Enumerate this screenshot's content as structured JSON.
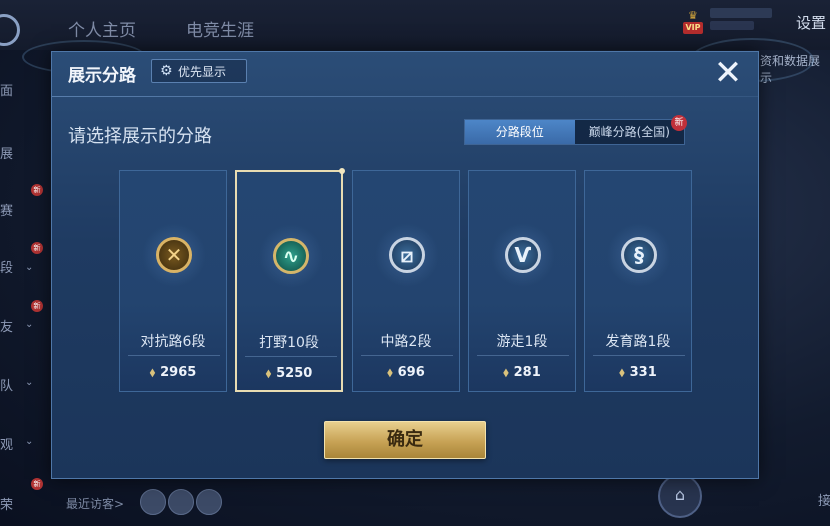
{
  "background": {
    "tabs": [
      "个人主页",
      "电竞生涯"
    ],
    "vip_label": "VIP",
    "settings_label": "设置",
    "right_text": "资和数据展示",
    "side_labels": [
      "面",
      "展",
      "赛",
      "新",
      "段",
      "友",
      "队",
      "观",
      "荣"
    ],
    "new_marker": "新",
    "visitors_label": "最近访客>",
    "bottom_char": "接"
  },
  "modal": {
    "title": "展示分路",
    "priority_button": "优先显示",
    "close_symbol": "✕",
    "subtitle": "请选择展示的分路",
    "toggle": {
      "active": "分路段位",
      "inactive": "巅峰分路(全国)",
      "new_badge": "新"
    },
    "lanes": [
      {
        "name": "对抗路6段",
        "points": "2965",
        "emblem": "crossed-swords-icon",
        "style": "gold",
        "selected": false
      },
      {
        "name": "打野10段",
        "points": "5250",
        "emblem": "dragon-icon",
        "style": "green",
        "selected": true
      },
      {
        "name": "中路2段",
        "points": "696",
        "emblem": "slash-icon",
        "style": "silver",
        "selected": false
      },
      {
        "name": "游走1段",
        "points": "281",
        "emblem": "wings-icon",
        "style": "silver",
        "selected": false
      },
      {
        "name": "发育路1段",
        "points": "331",
        "emblem": "swirl-icon",
        "style": "silver",
        "selected": false
      }
    ],
    "confirm_label": "确定"
  }
}
